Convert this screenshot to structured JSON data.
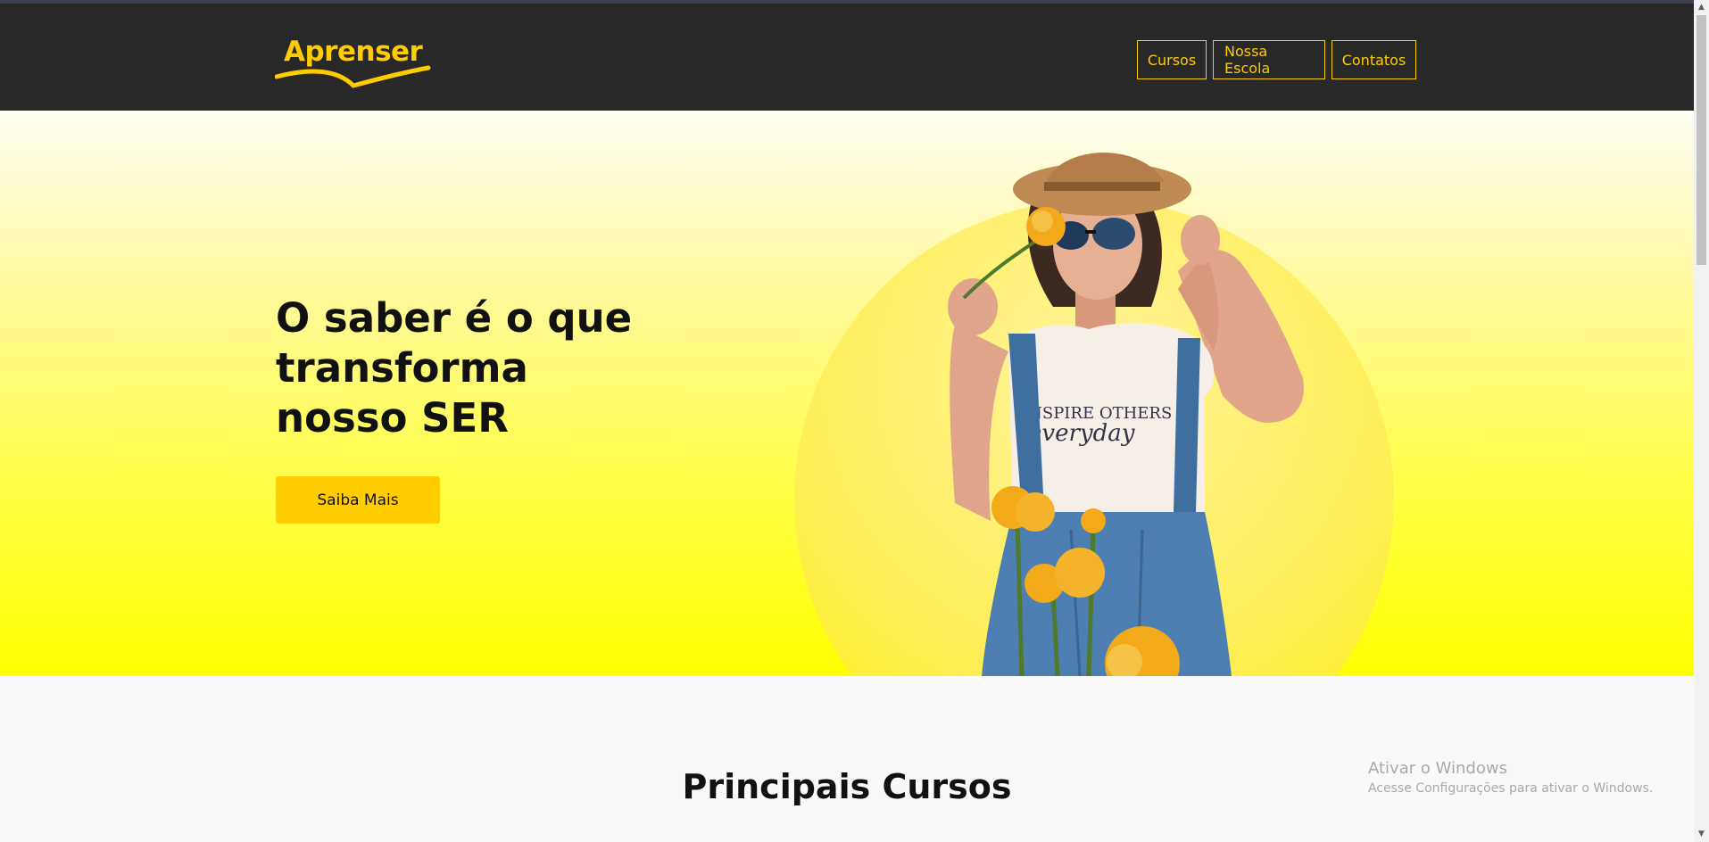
{
  "brand": {
    "name": "Aprenser",
    "color": "#ffcc00"
  },
  "nav": {
    "items": [
      {
        "label": "Cursos"
      },
      {
        "label": "Nossa Escola"
      },
      {
        "label": "Contatos"
      }
    ]
  },
  "hero": {
    "title": "O saber é o que transforma nosso SER",
    "cta_label": "Saiba Mais",
    "shirt_text_1": "INSPIRE OTHERS",
    "shirt_text_2": "everyday"
  },
  "courses": {
    "title": "Principais Cursos"
  },
  "watermark": {
    "line1": "Ativar o Windows",
    "line2": "Acesse Configurações para ativar o Windows."
  },
  "icons": {
    "scroll_up": "scroll-up-arrow-icon",
    "scroll_down": "scroll-down-arrow-icon"
  }
}
